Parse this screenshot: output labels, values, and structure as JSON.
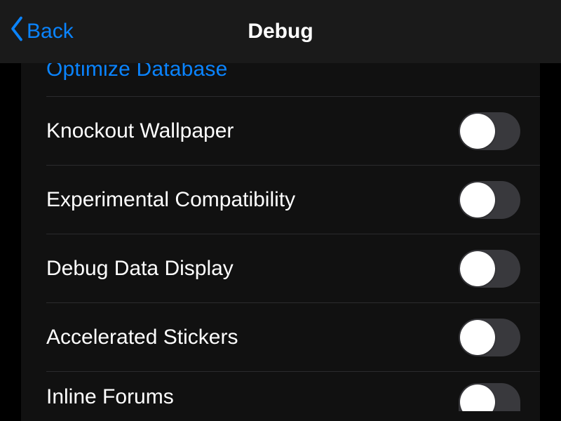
{
  "nav": {
    "back_label": "Back",
    "title": "Debug"
  },
  "rows": {
    "optimize_db": "Optimize Database",
    "knockout_wallpaper": {
      "label": "Knockout Wallpaper",
      "on": false
    },
    "experimental_compat": {
      "label": "Experimental Compatibility",
      "on": false
    },
    "debug_data_display": {
      "label": "Debug Data Display",
      "on": false
    },
    "accelerated_stickers": {
      "label": "Accelerated Stickers",
      "on": false
    },
    "inline_forums": {
      "label": "Inline Forums",
      "on": false
    }
  },
  "colors": {
    "accent": "#0a84ff",
    "bg": "#000000",
    "surface": "#111111",
    "navbar": "#1a1a1a",
    "separator": "#2b2b2d",
    "toggle_off": "#39393d",
    "knob": "#ffffff"
  }
}
